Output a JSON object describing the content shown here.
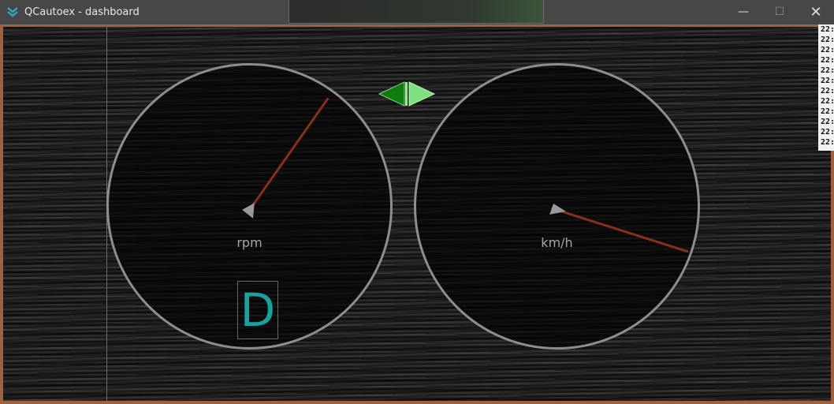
{
  "window": {
    "title": "QCautoex - dashboard",
    "minimize_glyph": "—",
    "maximize_glyph": "☐",
    "close_glyph": "✕"
  },
  "gauges": {
    "rpm": {
      "unit": "rpm"
    },
    "speed": {
      "unit": "km/h"
    }
  },
  "gear": {
    "label": "D"
  },
  "turn_signals": {
    "left_color": "#0f7a0f",
    "right_color": "#7fe07f"
  },
  "colors": {
    "frame_border": "#a0623d",
    "needle": "#8a2f1c",
    "gear_text": "#1ba0a0"
  },
  "log": [
    "22:",
    "22:",
    "22:",
    "22:",
    "22:",
    "22:",
    "22:",
    "22:",
    "22:",
    "22:",
    "22:",
    "22:"
  ]
}
